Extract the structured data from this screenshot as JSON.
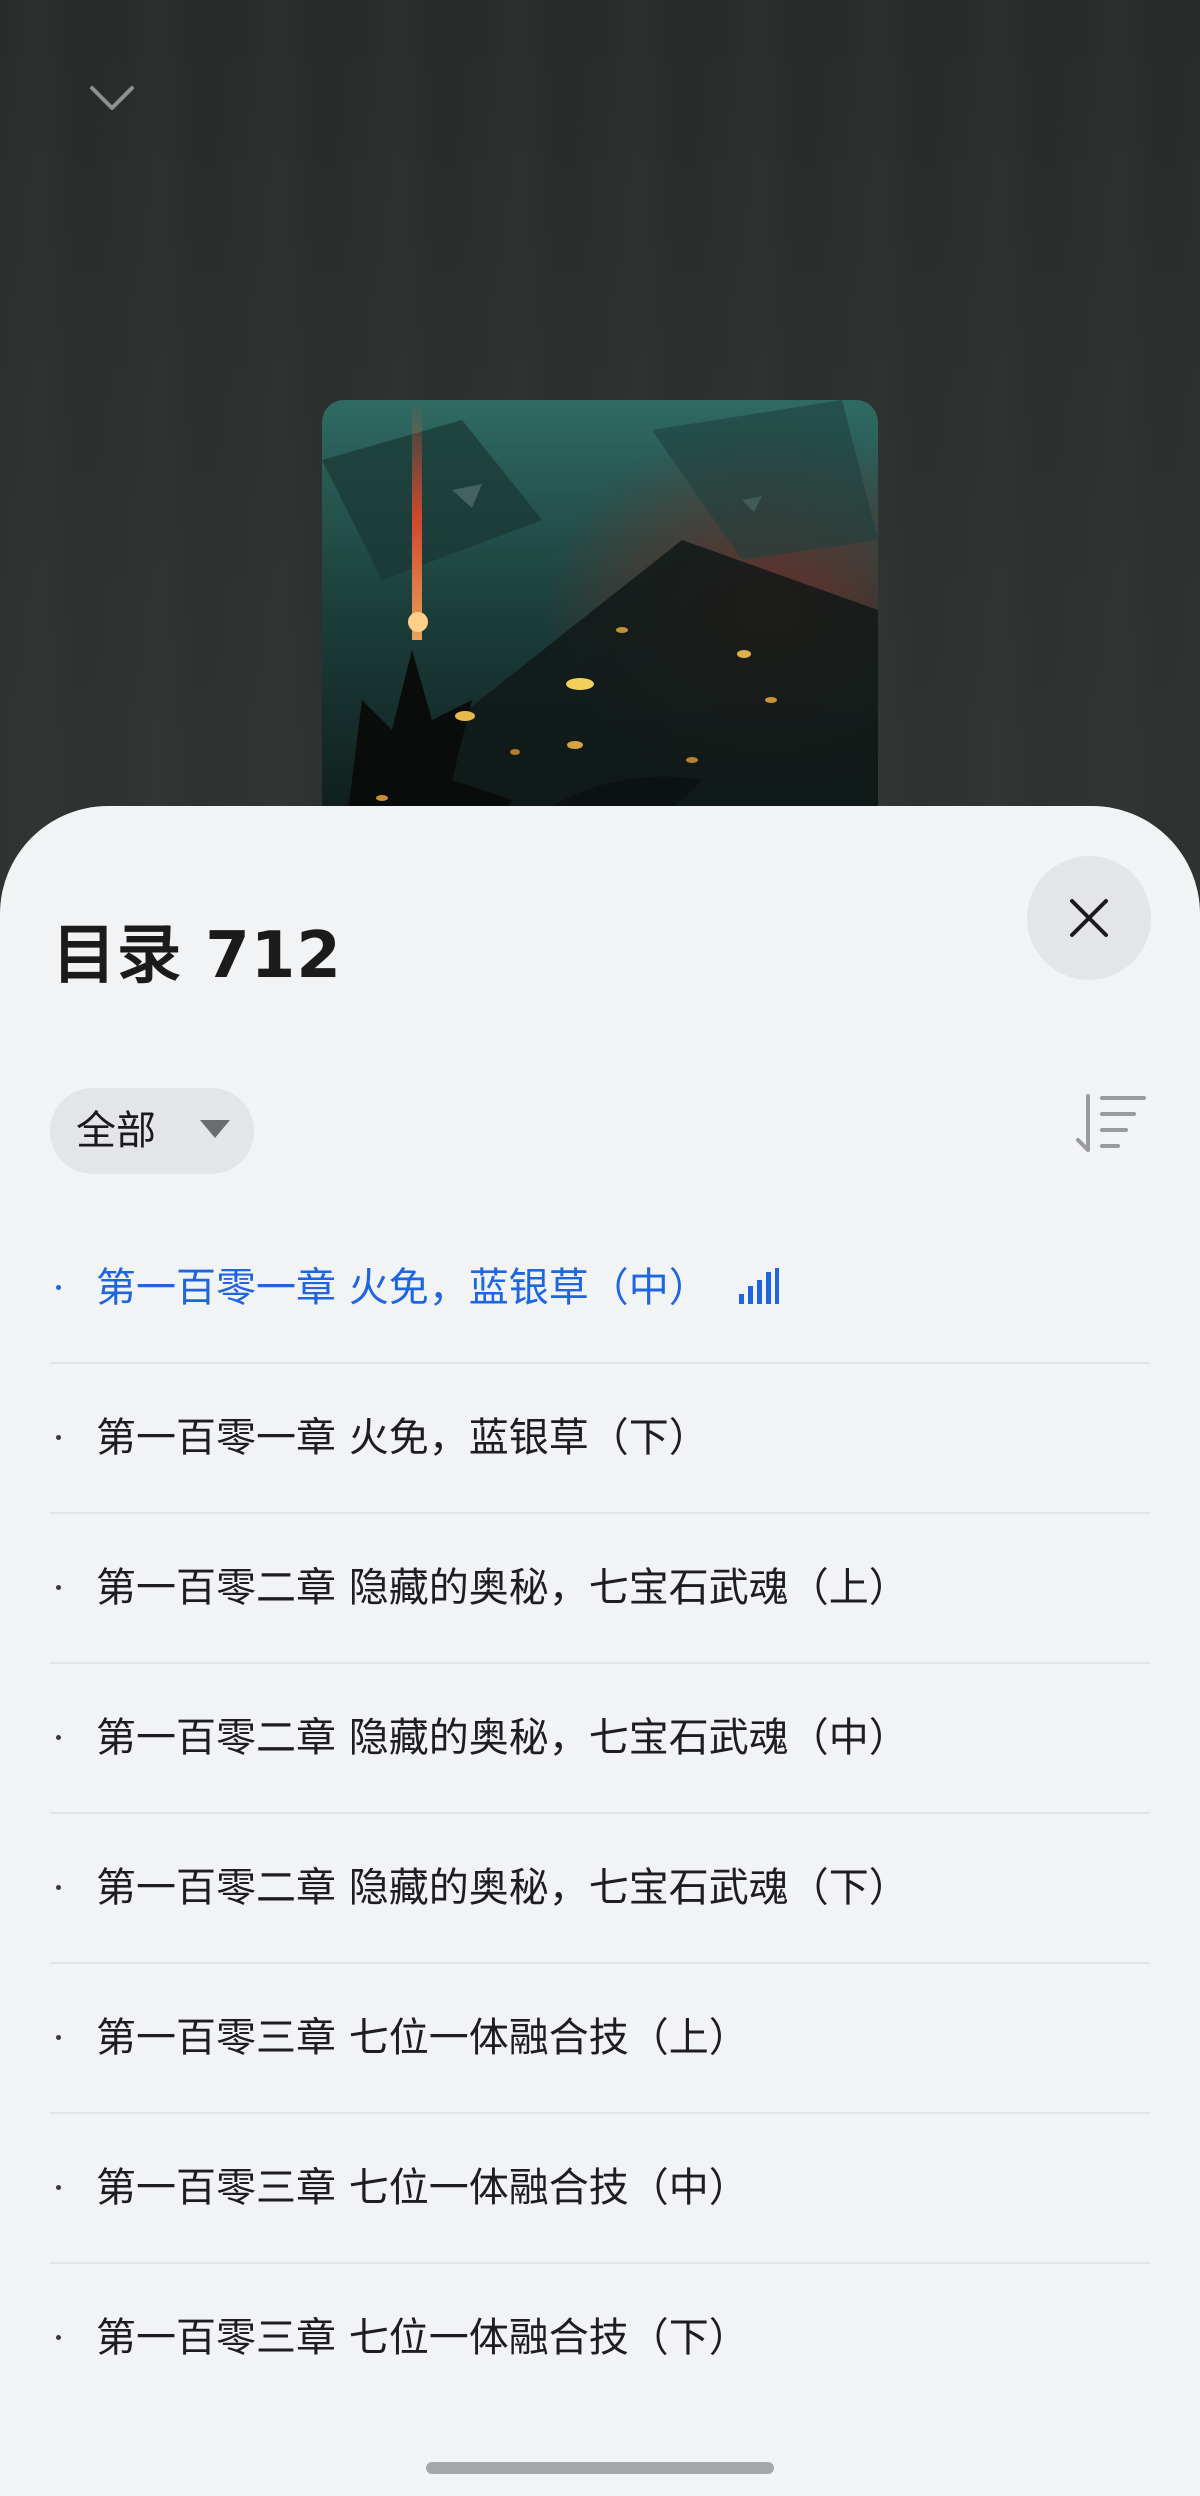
{
  "header": {
    "collapse_icon": "chevron-down-icon"
  },
  "catalog": {
    "title": "目录 712",
    "close_icon": "close-icon",
    "filter_label": "全部",
    "filter_icon": "triangle-down-icon",
    "sort_icon": "sort-order-icon",
    "accent_color": "#1f66de",
    "chapters": [
      {
        "title": "第一百零一章 火免，蓝银草（中）",
        "active": true,
        "status_icon": "audio-playing-icon"
      },
      {
        "title": "第一百零一章 火免，蓝银草（下）",
        "active": false
      },
      {
        "title": "第一百零二章 隐藏的奥秘，七宝石武魂（上）",
        "active": false
      },
      {
        "title": "第一百零二章 隐藏的奥秘，七宝石武魂（中）",
        "active": false
      },
      {
        "title": "第一百零二章 隐藏的奥秘，七宝石武魂（下）",
        "active": false
      },
      {
        "title": "第一百零三章 七位一体融合技（上）",
        "active": false
      },
      {
        "title": "第一百零三章 七位一体融合技（中）",
        "active": false
      },
      {
        "title": "第一百零三章 七位一体融合技（下）",
        "active": false
      }
    ]
  }
}
